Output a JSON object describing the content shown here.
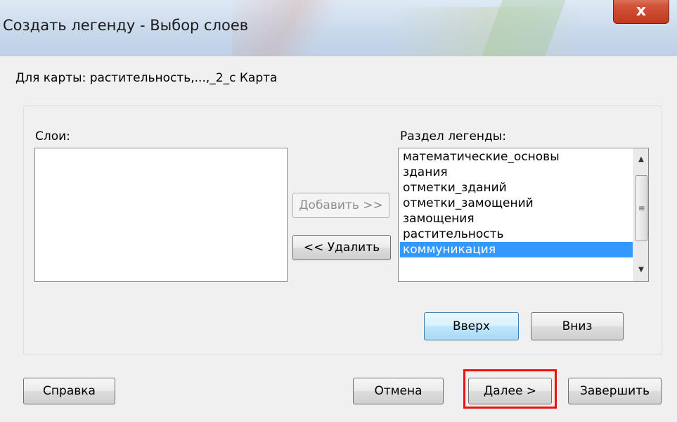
{
  "window": {
    "title": "Создать легенду - Выбор слоев",
    "close_label": "x"
  },
  "map_info": "Для карты:   растительность,...,_2_с Карта",
  "layers": {
    "label": "Слои:",
    "items": []
  },
  "legend_section": {
    "label": "Раздел легенды:",
    "items": [
      "математические_основы",
      "здания",
      "отметки_зданий",
      "отметки_замощений",
      "замощения",
      "растительность",
      "коммуникация"
    ],
    "selected_index": 6
  },
  "buttons": {
    "add": "Добавить >>",
    "remove": "<< Удалить",
    "up": "Вверх",
    "down": "Вниз",
    "help": "Справка",
    "cancel": "Отмена",
    "next": "Далее >",
    "finish": "Завершить"
  },
  "colors": {
    "selection": "#3399ff",
    "highlight_box": "#ee1111",
    "close_button": "#c0391f"
  }
}
